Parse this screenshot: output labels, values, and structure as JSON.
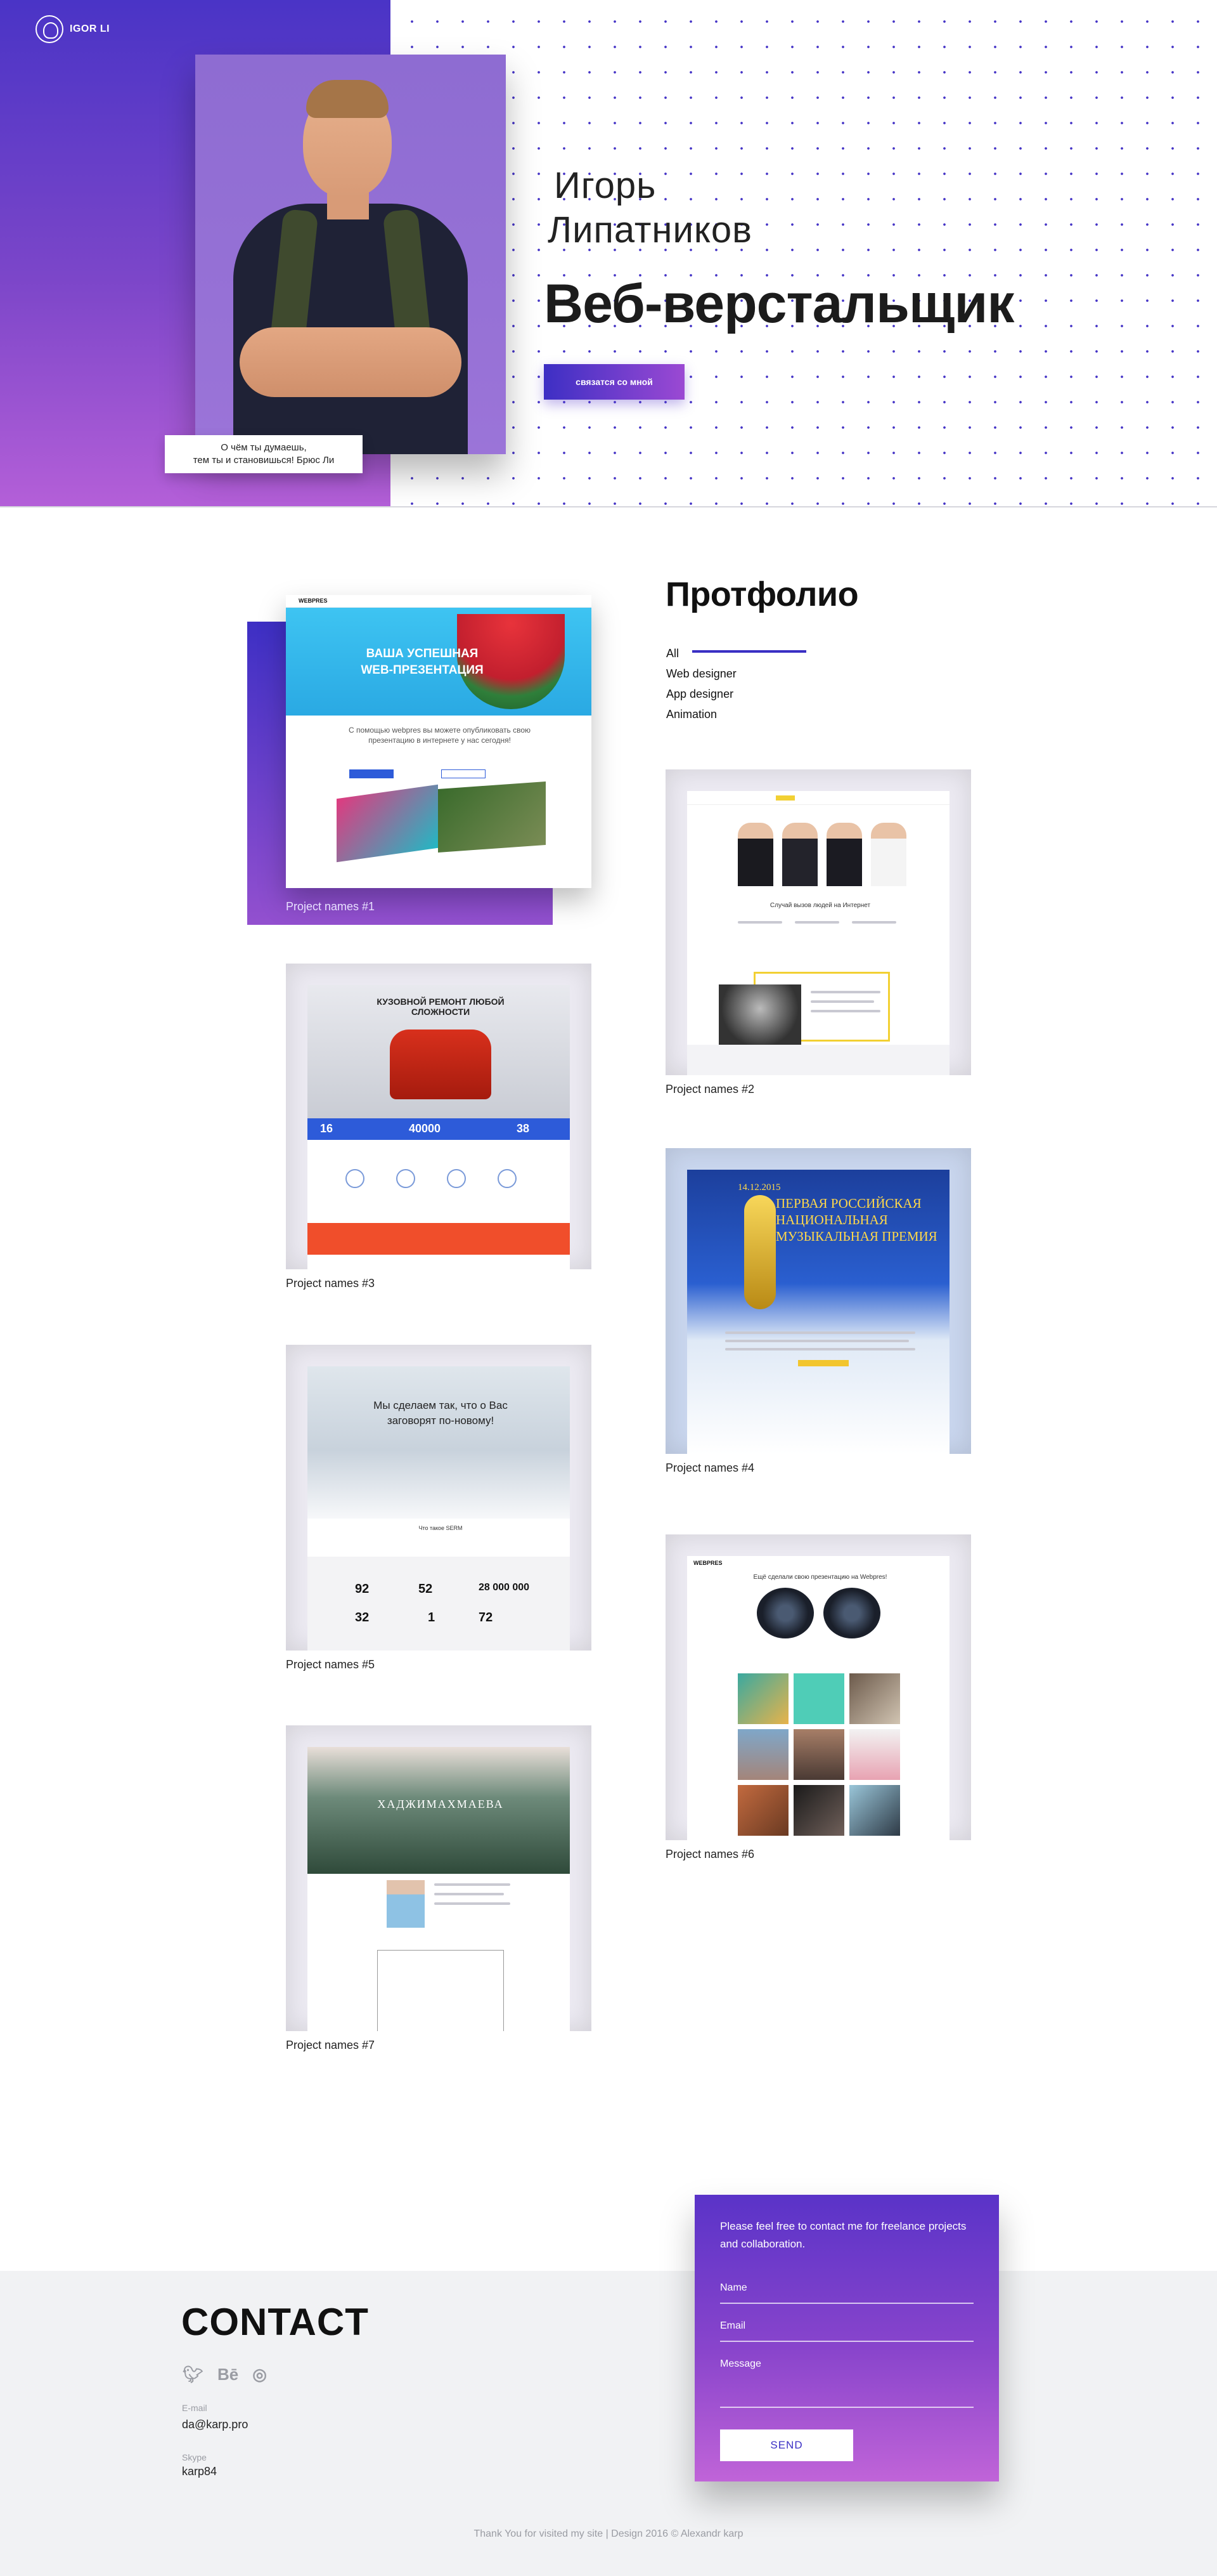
{
  "header": {
    "logo_text": "IGOR LI",
    "name_line1": "Игорь",
    "name_line2": "Липатников",
    "title": "Веб-верстальщик",
    "contact_button": "связатся со мной",
    "quote_line1": "О чём ты думаешь,",
    "quote_line2": "тем ты и  становишься! Брюс Ли"
  },
  "colors": {
    "accent": "#3a2fc4",
    "accent_purple": "#9b49d3",
    "contact_bg": "#f1f2f4"
  },
  "portfolio": {
    "title": "Протфолио",
    "filters": [
      "All",
      "Web designer",
      "App designer",
      "Animation"
    ],
    "projects": [
      {
        "caption": "Project names #1",
        "headline": "ВАША УСПЕШНАЯ WEB-ПРЕЗЕНТАЦИЯ",
        "logo": "WEBPRES",
        "subline": "С помощью webpres вы можете опубликовать свою презентацию в интернете у нас сегодня!"
      },
      {
        "caption": "Project names #2",
        "subline": "Случай вызов людей на Интернет"
      },
      {
        "caption": "Project names #3",
        "headline": "КУЗОВНОЙ РЕМОНТ ЛЮБОЙ СЛОЖНОСТИ",
        "stat1": "16",
        "stat2": "40000",
        "stat3": "38"
      },
      {
        "caption": "Project names #4",
        "date": "14.12.2015",
        "headline": "ПЕРВАЯ РОССИЙСКАЯ НАЦИОНАЛЬНАЯ МУЗЫКАЛЬНАЯ ПРЕМИЯ"
      },
      {
        "caption": "Project names #5",
        "headline_line1": "Мы сделаем так, что о Вас",
        "headline_line2": "заговорят по-новому!",
        "section": "Что такое SERM",
        "stat1": "92",
        "stat2": "52",
        "stat3": "28 000 000",
        "stat4": "32",
        "stat5": "1",
        "stat6": "72"
      },
      {
        "caption": "Project names #6",
        "logo": "WEBPRES",
        "headline": "Ещё сделали свою презентацию на Webpres!"
      },
      {
        "caption": "Project names #7",
        "headline": "ХАДЖИМАХМАЕВА"
      }
    ]
  },
  "contact": {
    "title": "CONTACT",
    "socials": [
      "twitter-icon",
      "behance-icon",
      "dribbble-icon"
    ],
    "email_label": "E-mail",
    "email": "da@karp.pro",
    "skype_label": "Skype",
    "skype": "karp84",
    "form_intro": "Please feel free to contact me for freelance projects and collaboration.",
    "name_placeholder": "Name",
    "email_placeholder": "Email",
    "message_placeholder": "Message",
    "send_label": "SEND"
  },
  "footer": {
    "text": "Thank You for visited my site | Design 2016 © Alexandr karp"
  }
}
